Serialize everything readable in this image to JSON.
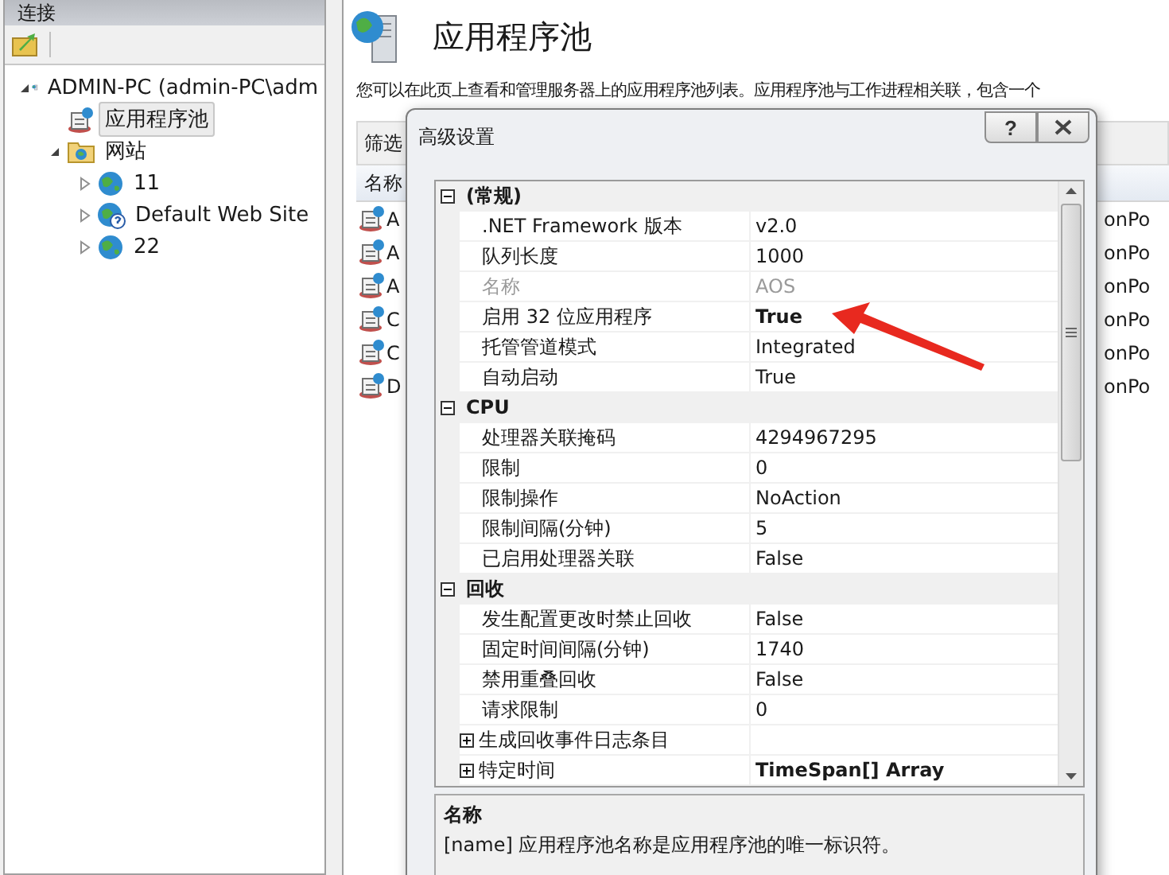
{
  "connections_panel": {
    "title": "连接"
  },
  "tree": [
    {
      "label": "ADMIN-PC (admin-PC\\adm",
      "kind": "server",
      "expanded": true,
      "selected": false,
      "children": [
        {
          "label": "应用程序池",
          "kind": "pool",
          "selected": true
        },
        {
          "label": "网站",
          "kind": "folder",
          "expanded": true,
          "selected": false,
          "children": [
            {
              "label": "11",
              "kind": "globe",
              "expanded": false,
              "selected": false
            },
            {
              "label": "Default Web Site",
              "kind": "globe-question",
              "expanded": false,
              "selected": false
            },
            {
              "label": "22",
              "kind": "globe",
              "expanded": false,
              "selected": false
            }
          ]
        }
      ]
    }
  ],
  "main": {
    "title": "应用程序池",
    "description": "您可以在此页上查看和管理服务器上的应用程序池列表。应用程序池与工作进程相关联，包含一个",
    "filter_label": "筛选",
    "list": {
      "columns": [
        "名称"
      ],
      "rows": [
        {
          "name": "A",
          "column_2": "onPo"
        },
        {
          "name": "A",
          "column_2": "onPo"
        },
        {
          "name": "A",
          "column_2": "onPo"
        },
        {
          "name": "C",
          "column_2": "onPo"
        },
        {
          "name": "C",
          "column_2": "onPo"
        },
        {
          "name": "D",
          "column_2": "onPo"
        }
      ]
    }
  },
  "dialog": {
    "title": "高级设置",
    "help_button": "?",
    "categories": [
      {
        "name": "(常规)",
        "expanded": true,
        "items": [
          {
            "name": ".NET Framework 版本",
            "value": "v2.0",
            "modified": false,
            "disabled": false
          },
          {
            "name": "队列长度",
            "value": "1000",
            "modified": false,
            "disabled": false
          },
          {
            "name": "名称",
            "value": "AOS",
            "modified": false,
            "disabled": true
          },
          {
            "name": "启用 32 位应用程序",
            "value": "True",
            "modified": true,
            "disabled": false
          },
          {
            "name": "托管管道模式",
            "value": "Integrated",
            "modified": false,
            "disabled": false
          },
          {
            "name": "自动启动",
            "value": "True",
            "modified": false,
            "disabled": false
          }
        ]
      },
      {
        "name": "CPU",
        "expanded": true,
        "items": [
          {
            "name": "处理器关联掩码",
            "value": "4294967295",
            "modified": false,
            "disabled": false
          },
          {
            "name": "限制",
            "value": "0",
            "modified": false,
            "disabled": false
          },
          {
            "name": "限制操作",
            "value": "NoAction",
            "modified": false,
            "disabled": false
          },
          {
            "name": "限制间隔(分钟)",
            "value": "5",
            "modified": false,
            "disabled": false
          },
          {
            "name": "已启用处理器关联",
            "value": "False",
            "modified": false,
            "disabled": false
          }
        ]
      },
      {
        "name": "回收",
        "expanded": true,
        "items": [
          {
            "name": "发生配置更改时禁止回收",
            "value": "False",
            "modified": false,
            "disabled": false
          },
          {
            "name": "固定时间间隔(分钟)",
            "value": "1740",
            "modified": false,
            "disabled": false
          },
          {
            "name": "禁用重叠回收",
            "value": "False",
            "modified": false,
            "disabled": false
          },
          {
            "name": "请求限制",
            "value": "0",
            "modified": false,
            "disabled": false
          },
          {
            "name": "生成回收事件日志条目",
            "disabled": false,
            "expanded": false
          },
          {
            "name": "特定时间",
            "value": "TimeSpan[] Array",
            "modified": true,
            "disabled": false,
            "expanded": false
          }
        ]
      }
    ],
    "description_panel": {
      "title": "名称",
      "text": "[name] 应用程序池名称是应用程序池的唯一标识符。"
    }
  }
}
